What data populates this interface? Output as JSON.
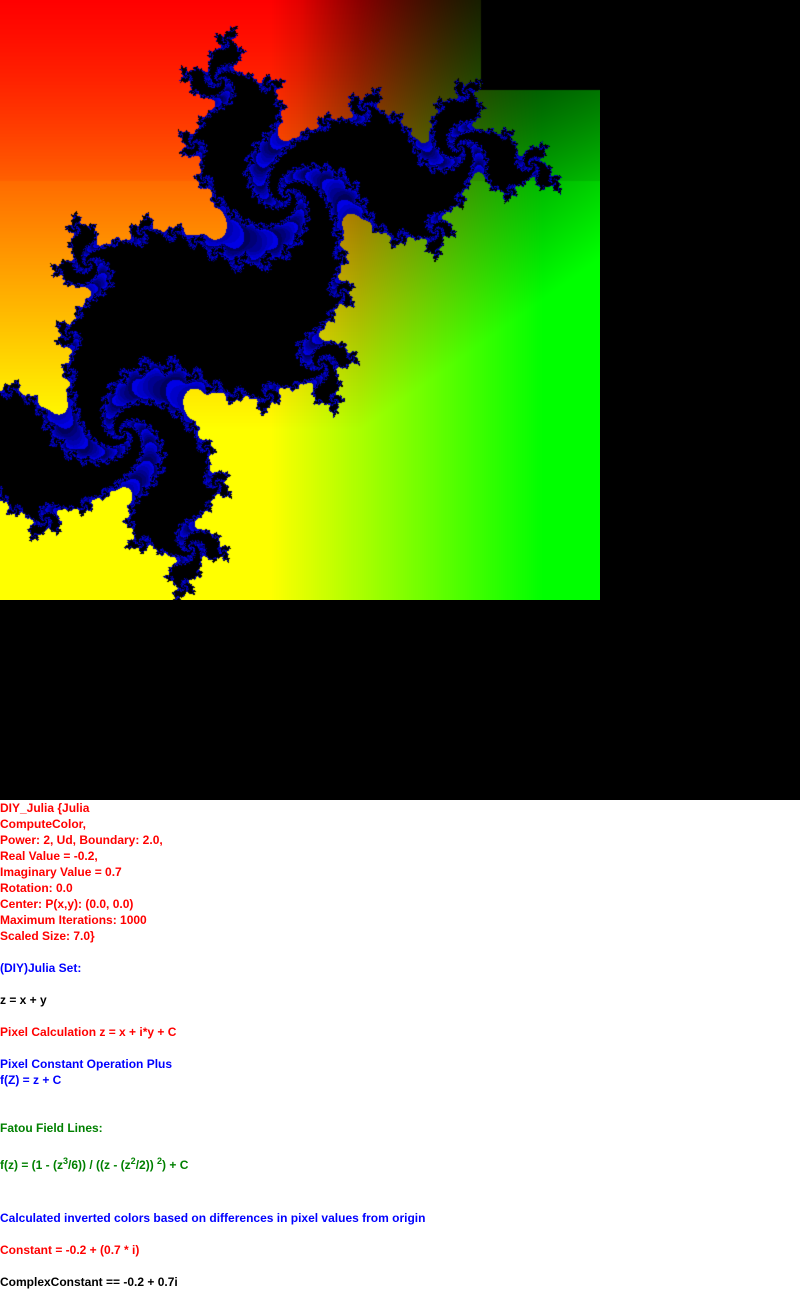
{
  "params": {
    "title": "DIY_Julia {Julia",
    "compute": "ComputeColor,",
    "power": "Power: 2, Ud, Boundary: 2.0,",
    "real": "Real Value = -0.2,",
    "imag": "Imaginary Value = 0.7",
    "rotation": "Rotation: 0.0",
    "center": "Center: P(x,y): (0.0, 0.0)",
    "maxiter": "Maximum Iterations: 1000",
    "scaled": "Scaled Size: 7.0}"
  },
  "heading": "(DIY)Julia Set:",
  "z_def": "z = x + y",
  "pixel_calc": "Pixel Calculation z = x + i*y + C",
  "constant_op": "Pixel Constant Operation Plus",
  "fz": "f(Z) = z + C",
  "fatou": "Fatou Field Lines:",
  "formula": {
    "p1": "f(z) = (1 - (z",
    "e1": "3",
    "p2": "/6)) / ((z - (z",
    "e2": "2",
    "p3": "/2)) ",
    "e3": "2",
    "p4": ") + C"
  },
  "inverted": "Calculated inverted colors based on differences in pixel values from origin",
  "constant": "Constant = -0.2 + (0.7 * i)",
  "complex_constant": "ComplexConstant == -0.2 + 0.7i",
  "fractal": {
    "c_re": -0.2,
    "c_im": 0.7,
    "max_iter": 1000,
    "bailout": 2.0,
    "scale": 7.0
  }
}
